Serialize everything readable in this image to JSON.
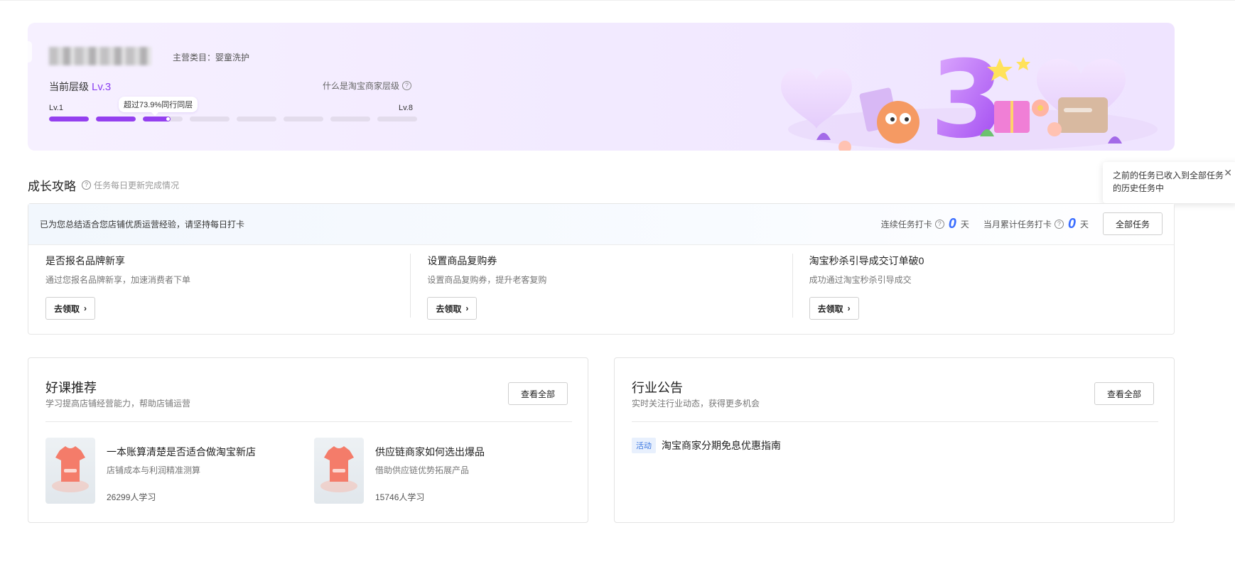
{
  "hero": {
    "category": "主营类目：婴童洗护",
    "level_label": "当前层级",
    "level_value": "Lv.3",
    "what_level": "什么是淘宝商家层级",
    "lv_start": "Lv.1",
    "lv_end": "Lv.8",
    "bubble": "超过73.9%同行同层",
    "hero_number": "3",
    "level_progress": {
      "current_level": 3,
      "max_level": 8,
      "current_segment_fraction": 0.7
    }
  },
  "growth": {
    "title": "成长攻略",
    "subtitle": "任务每日更新完成情况",
    "tip": "之前的任务已收入到全部任务的历史任务中",
    "banner_text": "已为您总结适合您店铺优质运营经验，请坚持每日打卡",
    "streak_label": "连续任务打卡",
    "streak_value": "0",
    "streak_unit": "天",
    "monthly_label": "当月累计任务打卡",
    "monthly_value": "0",
    "monthly_unit": "天",
    "all_tasks_button": "全部任务",
    "tasks": [
      {
        "title": "是否报名品牌新享",
        "desc": "通过您报名品牌新享，加速消费者下单",
        "button": "去领取"
      },
      {
        "title": "设置商品复购券",
        "desc": "设置商品复购券，提升老客复购",
        "button": "去领取"
      },
      {
        "title": "淘宝秒杀引导成交订单破0",
        "desc": "成功通过淘宝秒杀引导成交",
        "button": "去领取"
      }
    ]
  },
  "courses": {
    "title": "好课推荐",
    "subtitle": "学习提高店铺经营能力，帮助店铺运营",
    "view_all": "查看全部",
    "items": [
      {
        "title": "一本账算清楚是否适合做淘宝新店",
        "desc": "店铺成本与利润精准测算",
        "count": "26299人学习"
      },
      {
        "title": "供应链商家如何选出爆品",
        "desc": "借助供应链优势拓展产品",
        "count": "15746人学习"
      }
    ]
  },
  "notices": {
    "title": "行业公告",
    "subtitle": "实时关注行业动态，获得更多机会",
    "view_all": "查看全部",
    "items": [
      {
        "tag": "活动",
        "text": "淘宝商家分期免息优惠指南"
      }
    ]
  },
  "colors": {
    "accent_purple": "#9440ef",
    "stat_blue": "#3a6dff",
    "tag_blue": "#3a76e0"
  }
}
